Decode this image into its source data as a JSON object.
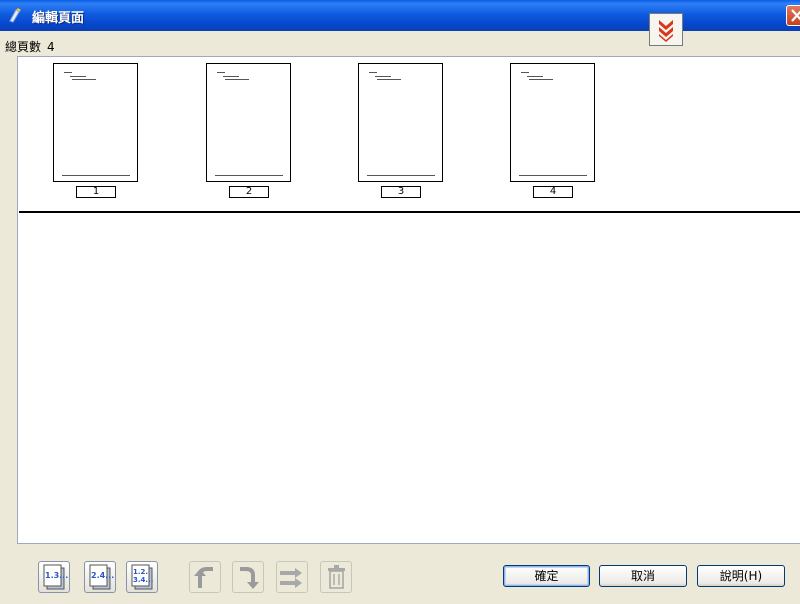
{
  "window": {
    "title": "編輯頁面",
    "icon": "edit-pages-icon"
  },
  "header": {
    "page_count_label": "總頁數",
    "page_count": "4"
  },
  "pages": [
    {
      "number": "1"
    },
    {
      "number": "2"
    },
    {
      "number": "3"
    },
    {
      "number": "4"
    }
  ],
  "toolbar": {
    "icons": [
      "odd-pages-icon",
      "even-pages-icon",
      "all-pages-icon",
      "rotate-left-icon",
      "rotate-right-icon",
      "reorder-pages-icon",
      "trash-icon"
    ],
    "odd_label": "1.3...",
    "even_label": "2.4...",
    "all_label_1": "1.2.",
    "all_label_2": "3.4..."
  },
  "buttons": {
    "ok": "確定",
    "cancel": "取消",
    "help": "說明(H)"
  },
  "colors": {
    "titlebar": "#0a5fe8",
    "close": "#c7401e",
    "page_border": "#000000",
    "canvas": "#ffffff"
  }
}
